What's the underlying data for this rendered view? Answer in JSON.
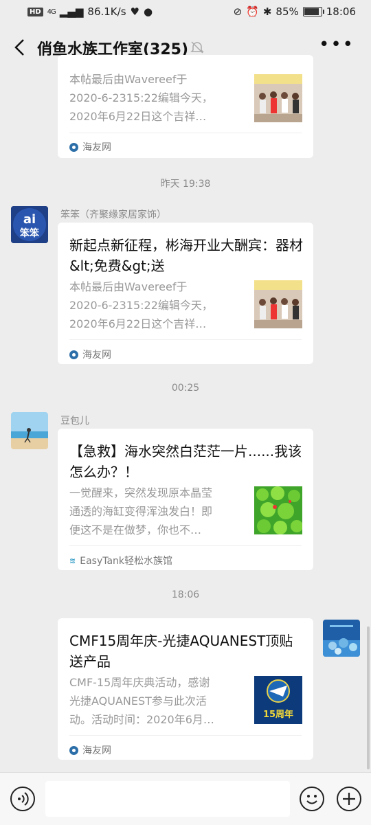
{
  "status_bar": {
    "speed": "86.1K/s",
    "hd": "HD",
    "net": "4G",
    "battery": "85%",
    "time": "18:06"
  },
  "header": {
    "title": "俏鱼水族工作室(325)",
    "more": "•••"
  },
  "messages": [
    {
      "title": "",
      "desc": [
        "本帖最后由Wavereef于",
        "2020-6-2315:22编辑今天，",
        "2020年6月22日这个吉祥…"
      ],
      "source": "海友网"
    },
    {
      "timestamp": "昨天 19:38",
      "sender": "笨笨（齐聚缘家居家饰）",
      "title": "新起点新征程，彬海开业大酬宾：器材&lt;免费&gt;送",
      "desc": [
        "本帖最后由Wavereef于",
        "2020-6-2315:22编辑今天，",
        "2020年6月22日这个吉祥…"
      ],
      "source": "海友网"
    },
    {
      "timestamp": "00:25",
      "sender": "豆包儿",
      "title": "【急救】海水突然白茫茫一片......我该怎么办？！",
      "desc": [
        "一觉醒来，突然发现原本晶莹",
        "通透的海缸变得浑浊发白！即",
        "便这不是在做梦，你也不…"
      ],
      "source": "EasyTank轻松水族馆"
    },
    {
      "timestamp": "18:06",
      "title": "CMF15周年庆-光捷AQUANEST顶贴送产品",
      "desc": [
        "CMF-15周年庆典活动，感谢",
        "光捷AQUANEST参与此次活",
        "动。活动时间：2020年6月…"
      ],
      "source": "海友网",
      "thumb_text": "15周年"
    }
  ],
  "avatars": {
    "benben_text": "ai\n笨笨"
  },
  "colors": {
    "background": "#ededed",
    "card": "#ffffff",
    "muted_text": "#8a8a8a",
    "source_icon": "#2c6fa8"
  }
}
